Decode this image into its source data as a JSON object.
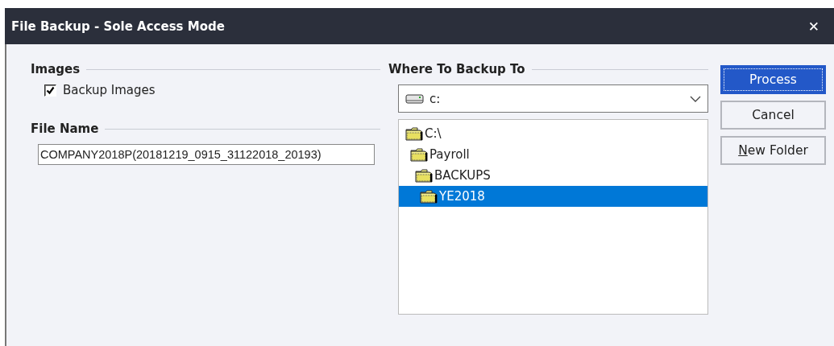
{
  "window": {
    "title": "File Backup - Sole Access Mode",
    "close": "✕"
  },
  "images": {
    "heading": "Images",
    "checkbox": {
      "label": "Backup Images",
      "checked": true
    }
  },
  "file_name": {
    "heading": "File Name",
    "value": "COMPANY2018P(20181219_0915_31122018_20193)"
  },
  "destination": {
    "heading": "Where To Backup To",
    "drive": "c:",
    "tree": [
      {
        "label": "C:\\",
        "selected": false,
        "children": [
          {
            "label": "Payroll",
            "selected": false,
            "children": [
              {
                "label": "BACKUPS",
                "selected": false,
                "children": [
                  {
                    "label": "YE2018",
                    "selected": true
                  }
                ]
              }
            ]
          }
        ]
      }
    ]
  },
  "buttons": [
    {
      "label": "Process",
      "default": true,
      "first_letter_underlined": false
    },
    {
      "label": "Cancel",
      "default": false,
      "first_letter_underlined": false
    },
    {
      "label": "New Folder",
      "default": false,
      "first_letter_underlined": true
    }
  ]
}
